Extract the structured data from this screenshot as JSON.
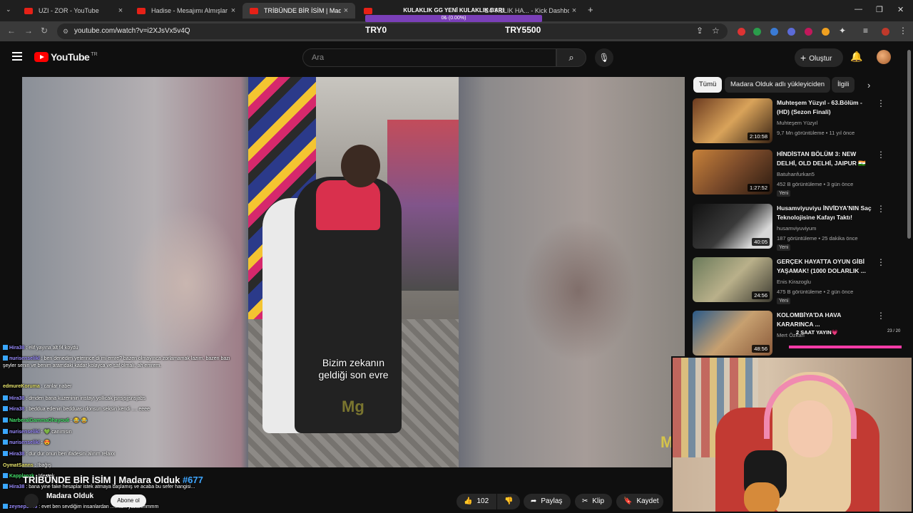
{
  "browser": {
    "tabs": [
      {
        "title": "UZI - ZOR - YouTube",
        "active": false
      },
      {
        "title": "Hadise - Mesajımı Almışlar",
        "active": false
      },
      {
        "title": "TRİBÜNDE BİR İSİM | Madara O",
        "active": true
      },
      {
        "title": "24 YILLIK HA... - Kick Dashboard",
        "active": false
      }
    ],
    "url": "youtube.com/watch?v=i2XJsVx5v4Q"
  },
  "overlay": {
    "title": "KULAKLIK GG YENİ KULAKLIK BARI",
    "progress_text": "0₺ (0.00%)",
    "progress": 0,
    "left_label": "TRY0",
    "right_label": "TRY5500"
  },
  "header": {
    "logo_text": "YouTube",
    "country_code": "TR",
    "search_placeholder": "Ara",
    "create_label": "Oluştur"
  },
  "video": {
    "subtitle_line1": "Bizim zekanın",
    "subtitle_line2": "geldiği son evre",
    "watermark": "Mg",
    "title": "TRİBÜNDE BİR İSİM | Madara Olduk ",
    "episode": "#677",
    "channel": "Madara Olduk",
    "subscribe_label": "Abone ol",
    "likes": "102",
    "share_label": "Paylaş",
    "clip_label": "Klip",
    "save_label": "Kaydet"
  },
  "chat": [
    {
      "user": "Hira38",
      "text": ": elif yayına alt f4 koydu",
      "color": "p"
    },
    {
      "user": "nurisenselikl",
      "text": ": ben denedim yeterince di mi emre? bazen olmayınca zorlamamak lazım. bazen bazı şeyler senin ve benim aramdaki kadar kolayca ve saf olmalı. ah emrem.",
      "color": "p"
    },
    {
      "user": "edmureKoruma",
      "text": ": canlar naber",
      "color": "y"
    },
    {
      "user": "Hira38",
      "text": ": dmden bana kuzeninin instayı yollicak jsnsjsjjsnsjabs",
      "color": "p"
    },
    {
      "user": "Hira38",
      "text": ": beddua edenin bedduası donsun seksin kendi .... eeee",
      "color": "p"
    },
    {
      "user": "NarberalGammaOhayou6",
      "text": ": 😂 😂",
      "color": "g"
    },
    {
      "user": "nurisenselikl",
      "text": ": 💚 canımsın",
      "color": "p"
    },
    {
      "user": "nurisenselikl",
      "text": ": 😍",
      "color": "p"
    },
    {
      "user": "Hira38",
      "text": ": dur dur onun ben ifadesini alırım relaxx",
      "color": "p"
    },
    {
      "user": "OymatSanns",
      "text": ": !bağış",
      "color": "y"
    },
    {
      "user": "Kapplanzk",
      "text": ": !destek",
      "color": "g"
    },
    {
      "user": "Hira38",
      "text": ": bana yine fake hesaplar istek atmaya başlamış ve acaba bu sefer hangisi...",
      "color": "p"
    },
    {
      "user": "zeynep3846",
      "text": ": evet ben sevdiğim insanlardan ....mam yazarımmmm",
      "color": "p"
    }
  ],
  "sidebar": {
    "chips": [
      "Tümü",
      "Madara Olduk adlı yükleyiciden",
      "İlgili"
    ],
    "recommendations": [
      {
        "title": "Muhteşem Yüzyıl - 63.Bölüm - (HD) (Sezon Finali)",
        "channel": "Muhteşem Yüzyıl",
        "meta": "9,7 Mn görüntüleme • 11 yıl önce",
        "duration": "2:10:58",
        "new": ""
      },
      {
        "title": "HİNDİSTAN BÖLÜM 3: NEW DELHİ, OLD DELHİ, JAIPUR 🇮🇳",
        "channel": "Batuhanfurkan5",
        "meta": "452 B görüntüleme • 3 gün önce",
        "duration": "1:27:52",
        "new": "Yeni"
      },
      {
        "title": "Husamviyuviyu İNVİDYA'NIN Saç Teknolojisine Kafayı Taktı!",
        "channel": "husamviyuviyum",
        "meta": "187 görüntüleme • 25 dakika önce",
        "duration": "40:05",
        "new": "Yeni"
      },
      {
        "title": "GERÇEK HAYATTA OYUN GİBİ YAŞAMAK! (1000 DOLARLIK ...",
        "channel": "Enis Kirazoglu",
        "meta": "475 B görüntüleme • 2 gün önce",
        "duration": "24:56",
        "new": "Yeni"
      },
      {
        "title": "KOLOMBİYA'DA HAVA KARARINCA ...",
        "channel": "Mert Özkan",
        "meta": "",
        "duration": "48:56",
        "new": ""
      }
    ]
  },
  "live": {
    "label": "2 SAAT YAYIN💗",
    "count": "23 / 20",
    "progress": 1.0
  },
  "colors": {
    "accent": "#ff0000",
    "link": "#3ea6ff",
    "overlay_bar": "#7a3fb8",
    "live_bar": "#ff3ca8"
  }
}
